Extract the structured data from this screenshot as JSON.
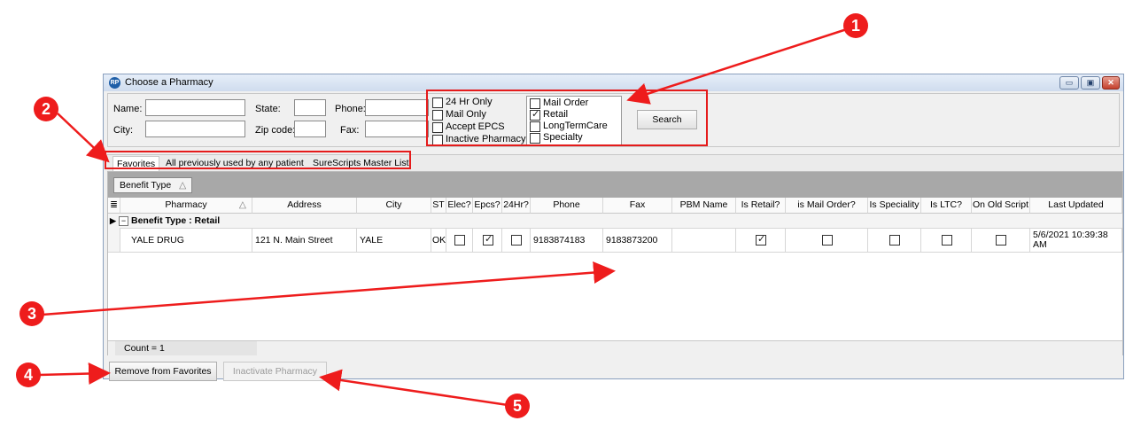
{
  "window": {
    "title": "Choose a Pharmacy",
    "icon": "pharmacy-logo-icon",
    "minimize_glyph": "▭",
    "restore_glyph": "▣",
    "close_glyph": "✕"
  },
  "search": {
    "name_label": "Name:",
    "city_label": "City:",
    "state_label": "State:",
    "zip_label": "Zip code:",
    "phone_label": "Phone:",
    "fax_label": "Fax:",
    "name_value": "",
    "city_value": "",
    "state_value": "",
    "zip_value": "",
    "phone_value": "",
    "fax_value": "",
    "flags": [
      {
        "label": "24 Hr Only",
        "checked": false
      },
      {
        "label": "Mail Only",
        "checked": false
      },
      {
        "label": "Accept EPCS",
        "checked": false
      },
      {
        "label": "Inactive Pharmacy",
        "checked": false
      }
    ],
    "types": [
      {
        "label": "Mail Order",
        "checked": false
      },
      {
        "label": "Retail",
        "checked": true
      },
      {
        "label": "LongTermCare",
        "checked": false
      },
      {
        "label": "Specialty",
        "checked": false
      }
    ],
    "search_button": "Search"
  },
  "tabs": [
    {
      "label": "Favorites",
      "selected": true
    },
    {
      "label": "All previously used by any patient",
      "selected": false
    },
    {
      "label": "SureScripts Master List",
      "selected": false
    }
  ],
  "grid": {
    "group_chip": "Benefit Type",
    "sort_glyph": "△",
    "columns": [
      "Pharmacy",
      "Address",
      "City",
      "ST",
      "Elec?",
      "Epcs?",
      "24Hr?",
      "Phone",
      "Fax",
      "PBM Name",
      "Is Retail?",
      "is Mail Order?",
      "Is Speciality",
      "Is LTC?",
      "On Old Script",
      "Last Updated"
    ],
    "group_row": "Benefit Type : Retail",
    "rows": [
      {
        "pharmacy": "YALE DRUG",
        "address": "121 N. Main Street",
        "city": "YALE",
        "st": "OK",
        "elec": false,
        "epcs": true,
        "hr24": false,
        "phone": "9183874183",
        "fax": "9183873200",
        "pbm": "",
        "is_retail": true,
        "is_mail": false,
        "is_specialty": false,
        "is_ltc": false,
        "on_old_script": false,
        "last_updated": "5/6/2021 10:39:38 AM"
      }
    ],
    "count": "Count = 1"
  },
  "buttons": {
    "remove_favorites": "Remove from Favorites",
    "inactivate": "Inactivate Pharmacy"
  },
  "annotations": [
    "1",
    "2",
    "3",
    "4",
    "5"
  ],
  "colors": {
    "annotation": "#ee1c1c",
    "title_bar": "#dce6f4",
    "group_area": "#a8a8a8"
  }
}
